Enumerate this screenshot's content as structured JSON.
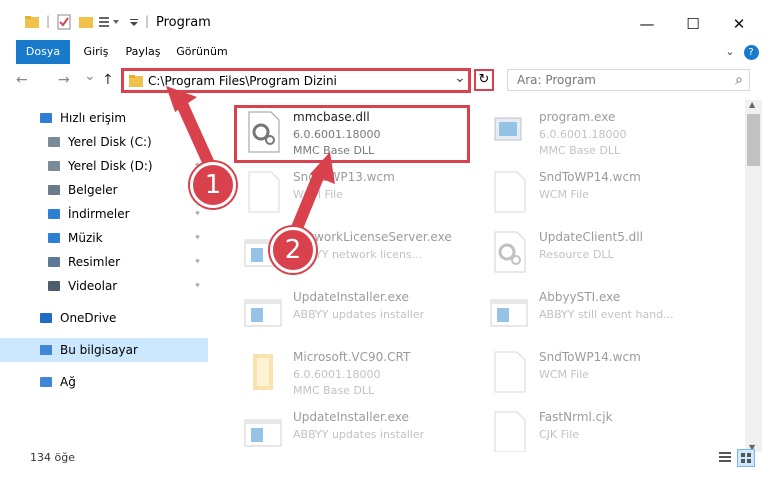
{
  "window": {
    "title": "Program",
    "minimize_icon": "minimize-icon",
    "maximize_icon": "maximize-icon",
    "close_icon": "close-icon",
    "minimize_glyph": "—",
    "maximize_glyph": "☐",
    "close_glyph": "✕"
  },
  "ribbon": {
    "tabs": [
      "Dosya",
      "Giriş",
      "Paylaş",
      "Görünüm"
    ],
    "file_color": "#1979ca",
    "expand_glyph": "⌄",
    "help_glyph": "?"
  },
  "nav": {
    "back_glyph": "←",
    "forward_glyph": "→",
    "recent_glyph": "⌄",
    "up_glyph": "↑",
    "address": "C:\\Program Files\\Program Dizini",
    "address_dropdown_glyph": "⌄",
    "refresh_glyph": "↻",
    "search_placeholder": "Ara: Program",
    "search_glyph": "⌕"
  },
  "sidebar": {
    "items": [
      {
        "label": "Hızlı erişim",
        "icon": "star-icon",
        "pinned": false
      },
      {
        "label": "Yerel Disk (C:)",
        "icon": "drive-icon",
        "pinned": true
      },
      {
        "label": "Yerel Disk (D:)",
        "icon": "drive-icon",
        "pinned": true
      },
      {
        "label": "Belgeler",
        "icon": "documents-icon",
        "pinned": true
      },
      {
        "label": "İndirmeler",
        "icon": "download-icon",
        "pinned": true
      },
      {
        "label": "Müzik",
        "icon": "music-icon",
        "pinned": true
      },
      {
        "label": "Resimler",
        "icon": "pictures-icon",
        "pinned": true
      },
      {
        "label": "Videolar",
        "icon": "video-icon",
        "pinned": true
      },
      {
        "label": "OneDrive",
        "icon": "cloud-icon",
        "pinned": false
      },
      {
        "label": "Bu bilgisayar",
        "icon": "computer-icon",
        "pinned": false,
        "selected": true
      },
      {
        "label": "Ağ",
        "icon": "network-icon",
        "pinned": false
      }
    ],
    "pin_glyph": "📌"
  },
  "files": [
    {
      "name": "mmcbase.dll",
      "line2": "6.0.6001.18000",
      "line3": "MMC Base DLL",
      "icon": "dll-gear-icon",
      "highlight": true
    },
    {
      "name": "program.exe",
      "line2": "6.0.6001.18000",
      "line3": "MMC Base DLL",
      "icon": "exe-icon"
    },
    {
      "name": "SndToWP13.wcm",
      "line2": "WCM File",
      "line3": "",
      "icon": "blank-file-icon"
    },
    {
      "name": "SndToWP14.wcm",
      "line2": "WCM File",
      "line3": "",
      "icon": "blank-file-icon"
    },
    {
      "name": "NetworkLicenseServer.exe",
      "line2": "ABBYY network licens...",
      "line3": "",
      "icon": "app-window-icon"
    },
    {
      "name": "UpdateClient5.dll",
      "line2": "Resource DLL",
      "line3": "",
      "icon": "dll-gear-icon"
    },
    {
      "name": "UpdateInstaller.exe",
      "line2": "ABBYY updates installer",
      "line3": "",
      "icon": "app-window-icon"
    },
    {
      "name": "AbbyySTI.exe",
      "line2": "ABBYY still event hand...",
      "line3": "",
      "icon": "app-window-icon"
    },
    {
      "name": "Microsoft.VC90.CRT",
      "line2": "6.0.6001.18000",
      "line3": "MMC Base DLL",
      "icon": "folder-icon"
    },
    {
      "name": "SndToWP14.wcm",
      "line2": "WCM File",
      "line3": "",
      "icon": "blank-file-icon"
    },
    {
      "name": "UpdateInstaller.exe",
      "line2": "ABBYY updates installer",
      "line3": "",
      "icon": "app-window-icon"
    },
    {
      "name": "FastNrml.cjk",
      "line2": "CJK File",
      "line3": "",
      "icon": "blank-file-icon"
    }
  ],
  "status": {
    "count": "134 öğe",
    "details_view_icon": "details-view-icon",
    "large_icons_view_icon": "large-icons-view-icon"
  },
  "annotations": {
    "step1": "1",
    "step2": "2",
    "color": "#d9414c"
  }
}
